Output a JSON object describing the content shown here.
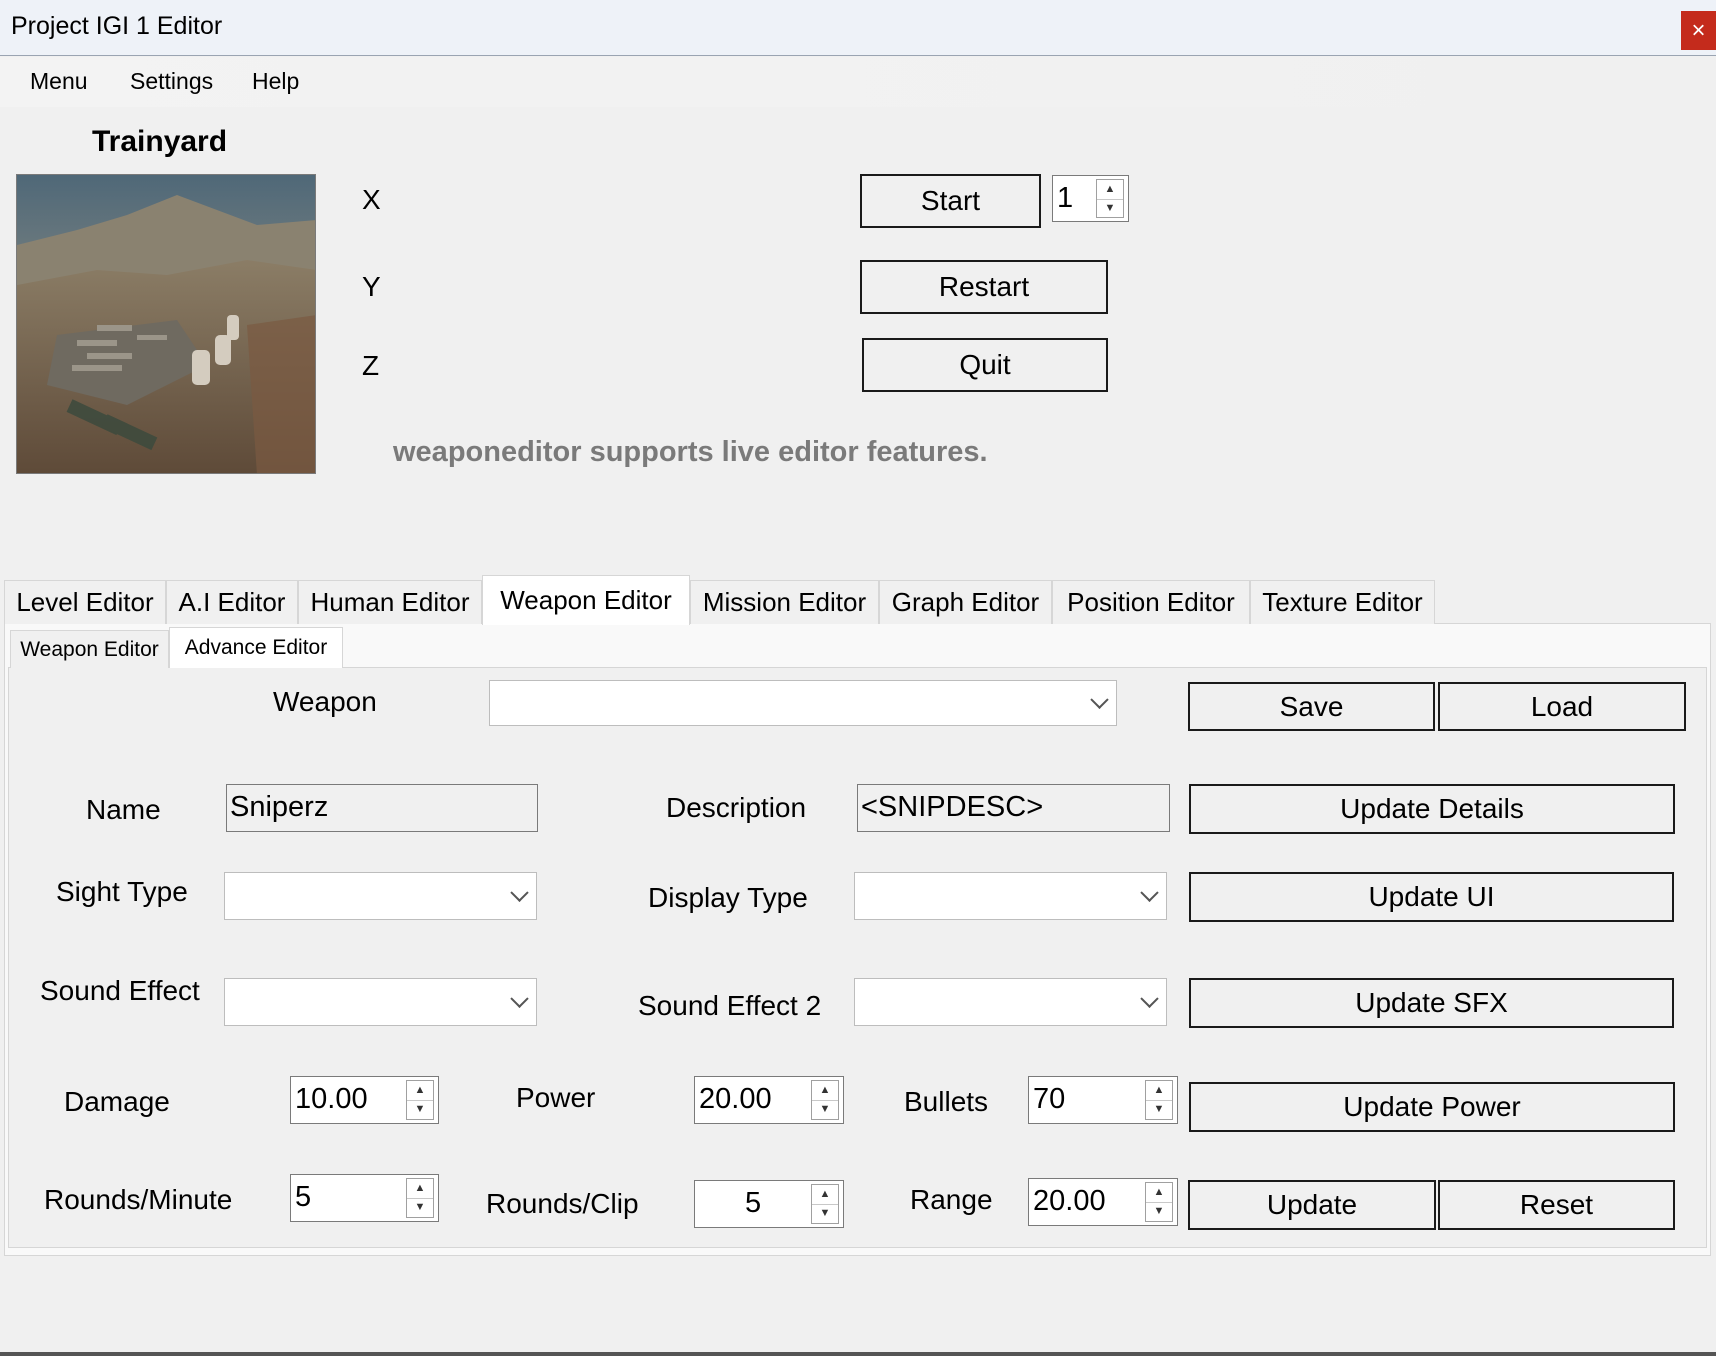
{
  "window": {
    "title": "Project IGI 1 Editor",
    "close_glyph": "×"
  },
  "menu": [
    {
      "label": "Menu"
    },
    {
      "label": "Settings"
    },
    {
      "label": "Help"
    }
  ],
  "level": {
    "name": "Trainyard",
    "thumbnail": "level-thumbnail"
  },
  "coords": {
    "x_label": "X",
    "y_label": "Y",
    "z_label": "Z"
  },
  "controls": {
    "start_label": "Start",
    "restart_label": "Restart",
    "quit_label": "Quit",
    "level_number": "1"
  },
  "status_message": "weaponeditor supports live editor features.",
  "main_tabs": [
    {
      "label": "Level Editor"
    },
    {
      "label": "A.I Editor"
    },
    {
      "label": "Human Editor"
    },
    {
      "label": "Weapon Editor",
      "active": true
    },
    {
      "label": "Mission Editor"
    },
    {
      "label": "Graph Editor"
    },
    {
      "label": "Position Editor"
    },
    {
      "label": "Texture Editor"
    }
  ],
  "sub_tabs": [
    {
      "label": "Weapon Editor"
    },
    {
      "label": "Advance Editor",
      "active": true
    }
  ],
  "weapon_form": {
    "weapon_label": "Weapon",
    "weapon_value": "",
    "save_label": "Save",
    "load_label": "Load",
    "name_label": "Name",
    "name_value": "Sniperz",
    "description_label": "Description",
    "description_value": "<SNIPDESC>",
    "update_details_label": "Update Details",
    "sight_type_label": "Sight Type",
    "display_type_label": "Display Type",
    "update_ui_label": "Update UI",
    "sound_effect_label": "Sound Effect",
    "sound_effect2_label": "Sound Effect 2",
    "update_sfx_label": "Update SFX",
    "damage_label": "Damage",
    "damage_value": "10.00",
    "power_label": "Power",
    "power_value": "20.00",
    "bullets_label": "Bullets",
    "bullets_value": "70",
    "update_power_label": "Update Power",
    "rpm_label": "Rounds/Minute",
    "rpm_value": "5",
    "rounds_clip_label": "Rounds/Clip",
    "rounds_clip_value": "5",
    "range_label": "Range",
    "range_value": "20.00",
    "update_label": "Update",
    "reset_label": "Reset"
  },
  "colors": {
    "close_button": "#c42b1c",
    "status_text": "#7a7a7a",
    "window_bg": "#f0f0f0"
  }
}
